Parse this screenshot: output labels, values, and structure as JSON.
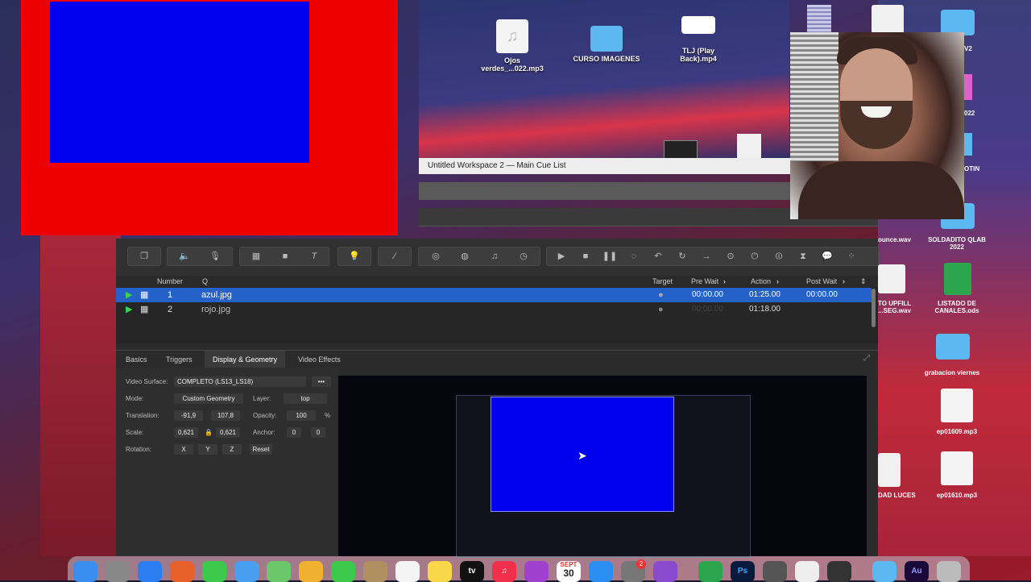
{
  "desktop": {
    "icons_top": [
      {
        "label": "Ojos\nverdes_...022.mp3",
        "kind": "audio"
      },
      {
        "label": "CURSO IMAGENES",
        "kind": "folder"
      },
      {
        "label": "TLJ (Play\nBack).mp4",
        "kind": "video"
      }
    ],
    "icons_right": [
      {
        "label": "V2",
        "kind": "folder"
      },
      {
        "label": "022",
        "kind": "file"
      },
      {
        "label": "OTIN",
        "kind": "folder"
      },
      {
        "label": "ounce.wav",
        "kind": "audio"
      },
      {
        "label": "SOLDADITO QLAB\n2022",
        "kind": "folder"
      },
      {
        "label": "TO UPFILL\n...SEG.wav",
        "kind": "audio"
      },
      {
        "label": "LISTADO DE\nCANALES.ods",
        "kind": "sheet"
      },
      {
        "label": "grabacion viernes",
        "kind": "folder"
      },
      {
        "label": "ep01609.mp3",
        "kind": "audio"
      },
      {
        "label": "DAD LUCES",
        "kind": "file"
      },
      {
        "label": "ep01610.mp3",
        "kind": "audio"
      }
    ]
  },
  "workspace": {
    "title": "Untitled Workspace 2 — Main Cue List"
  },
  "toolbar": {
    "cue_icons": [
      "group-icon",
      "audio-icon",
      "mic-icon",
      "video-icon",
      "camera-icon",
      "text-icon",
      "light-icon",
      "fade-icon",
      "network-icon",
      "midi-icon",
      "midi-file-icon",
      "timecode-icon"
    ],
    "transport_icons": [
      "start-icon",
      "stop-icon",
      "pause-icon",
      "load-icon",
      "reset-icon",
      "devamp-icon",
      "goto-icon",
      "target-icon",
      "arm-icon",
      "disarm-icon",
      "wait-icon",
      "memo-icon",
      "script-icon"
    ]
  },
  "cue_list": {
    "headers": {
      "number": "Number",
      "q": "Q",
      "target": "Target",
      "pre_wait": "Pre Wait",
      "action": "Action",
      "post_wait": "Post Wait"
    },
    "rows": [
      {
        "number": "1",
        "q": "azul.jpg",
        "pre_wait": "00:00.00",
        "action": "01:25.00",
        "post_wait": "00:00.00",
        "selected": true
      },
      {
        "number": "2",
        "q": "rojo.jpg",
        "pre_wait": "00:00.00",
        "action": "01:18.00",
        "post_wait": "",
        "selected": false
      }
    ]
  },
  "inspector": {
    "tabs": [
      "Basics",
      "Triggers",
      "Display & Geometry",
      "Video Effects"
    ],
    "active_tab": "Display & Geometry",
    "video_surface_label": "Video Surface:",
    "video_surface_value": "COMPLETO (LS13_LS18)",
    "mode_label": "Mode:",
    "mode_value": "Custom Geometry",
    "layer_label": "Layer:",
    "layer_value": "top",
    "translation_label": "Translation:",
    "translation_x": "-91,9",
    "translation_y": "107,8",
    "opacity_label": "Opacity:",
    "opacity_value": "100",
    "opacity_unit": "%",
    "scale_label": "Scale:",
    "scale_x": "0,621",
    "scale_y": "0,621",
    "anchor_label": "Anchor:",
    "anchor_x": "0",
    "anchor_y": "0",
    "rotation_label": "Rotation:",
    "rotation_x": "X",
    "rotation_y": "Y",
    "rotation_z": "Z",
    "reset_label": "Reset",
    "more_label": "•••"
  },
  "dock": {
    "apps": [
      "Finder",
      "Launchpad",
      "Safari",
      "Firefox",
      "Messages",
      "Mail",
      "Maps",
      "Photos",
      "FaceTime",
      "Contacts",
      "Reminders",
      "Notes",
      "tv",
      "Music",
      "Podcasts",
      "Calendar",
      "App Store",
      "System Preferences",
      "QLab",
      "Numbers",
      "Ps",
      "Automator",
      "Preview",
      "OBS",
      "Folder",
      "Au",
      "Trash"
    ],
    "calendar_month": "SEPT",
    "calendar_day": "30",
    "tv_label": "tv",
    "ps_label": "Ps",
    "au_label": "Au",
    "badge": "2"
  }
}
